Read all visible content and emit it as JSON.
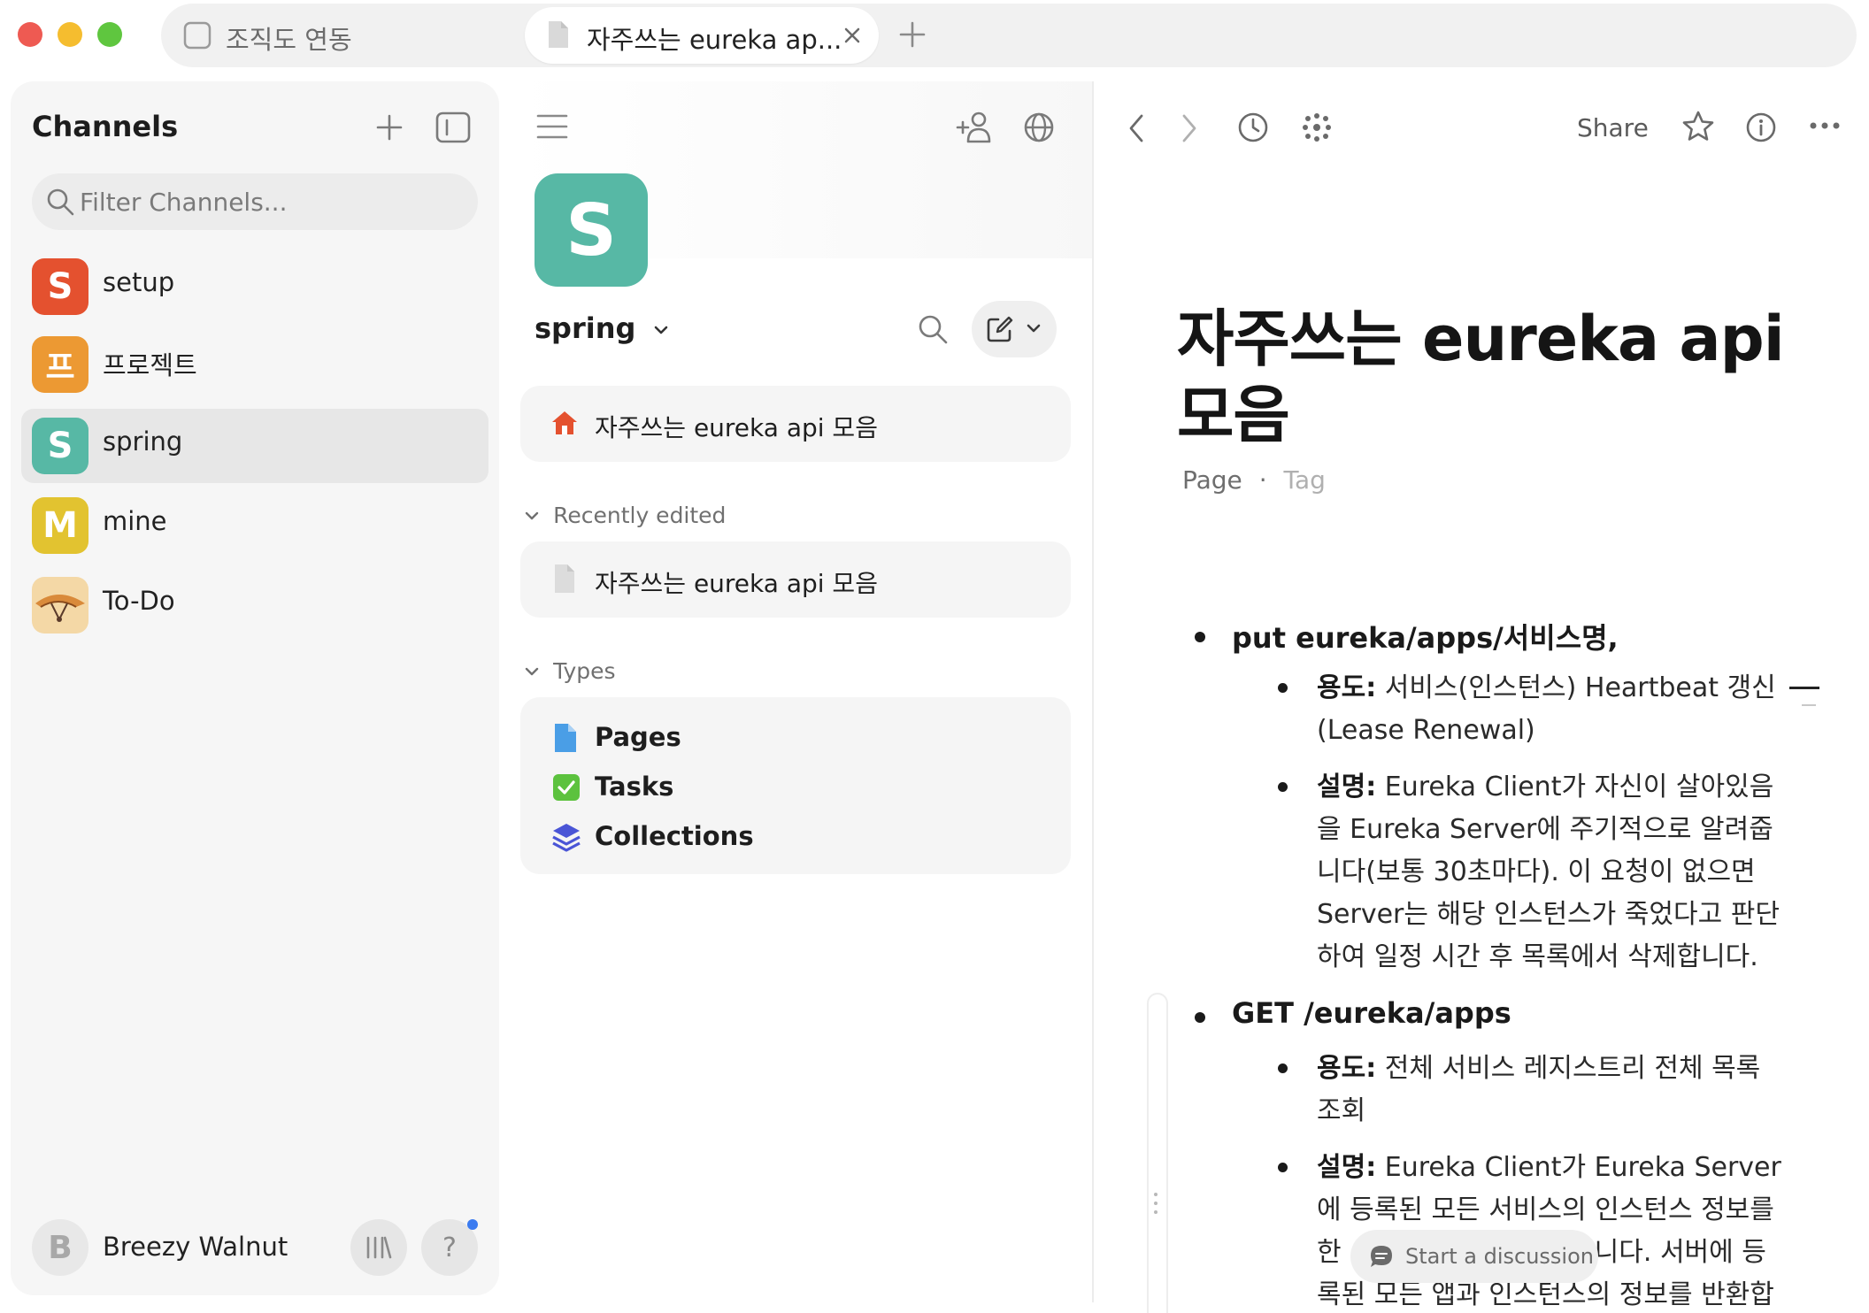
{
  "window": {
    "traffic_lights": [
      "#ee5a52",
      "#f5bd2f",
      "#5fc63f"
    ]
  },
  "tabs": [
    {
      "label": "조직도 연동",
      "icon": "checkbox-icon",
      "active": false
    },
    {
      "label": "자주쓰는 eureka ap...",
      "icon": "document-icon",
      "active": true
    }
  ],
  "sidebar": {
    "title": "Channels",
    "filter_placeholder": "Filter Channels...",
    "channels": [
      {
        "label": "setup",
        "initial": "S",
        "color": "#e4512f"
      },
      {
        "label": "프로젝트",
        "initial": "프",
        "color": "#ec9933"
      },
      {
        "label": "spring",
        "initial": "S",
        "color": "#57b8a5",
        "active": true
      },
      {
        "label": "mine",
        "initial": "M",
        "color": "#e2c330"
      },
      {
        "label": "To-Do",
        "initial": "",
        "color": "#f4d8a6"
      }
    ],
    "user": {
      "initial": "B",
      "name": "Breezy Walnut"
    },
    "library_icon": "|||\\",
    "help_label": "?"
  },
  "space": {
    "initial": "S",
    "color": "#57b8a5",
    "name": "spring",
    "home_item": "자주쓰는 eureka api 모음",
    "recently_edited_title": "Recently edited",
    "recent_items": [
      "자주쓰는 eureka api 모음"
    ],
    "types_title": "Types",
    "types": [
      {
        "label": "Pages",
        "icon": "page-icon"
      },
      {
        "label": "Tasks",
        "icon": "checkbox-icon"
      },
      {
        "label": "Collections",
        "icon": "layers-icon"
      }
    ]
  },
  "doc": {
    "share_label": "Share",
    "title_line1": "자주쓰는 eureka api",
    "title_line2": "모음",
    "meta_type": "Page",
    "meta_sep": "·",
    "meta_tag": "Tag",
    "bullets": [
      {
        "heading": "put eureka/apps/서비스명,",
        "subs": [
          {
            "label": "용도:",
            "lines": [
              " 서비스(인스턴스) Heartbeat 갱신",
              "(Lease Renewal)"
            ]
          },
          {
            "label": "설명:",
            "lines": [
              " Eureka Client가 자신이 살아있음",
              "을 Eureka Server에 주기적으로 알려줍",
              "니다(보통 30초마다). 이 요청이 없으면",
              "Server는 해당 인스턴스가 죽었다고 판단",
              "하여 일정 시간 후 목록에서 삭제합니다."
            ]
          }
        ]
      },
      {
        "heading": "GET /eureka/apps",
        "subs": [
          {
            "label": "용도:",
            "lines": [
              " 전체 서비스 레지스트리 전체 목록",
              "조회"
            ]
          },
          {
            "label": "설명:",
            "lines": [
              " Eureka Client가 Eureka Server",
              "에 등록된 모든 서비스의 인스턴스 정보를",
              "한                              니다. 서버에 등",
              "록된 모든 앱과 인스턴스의 정보를 반환합"
            ]
          }
        ]
      }
    ],
    "discussion_label": "Start a discussion"
  }
}
